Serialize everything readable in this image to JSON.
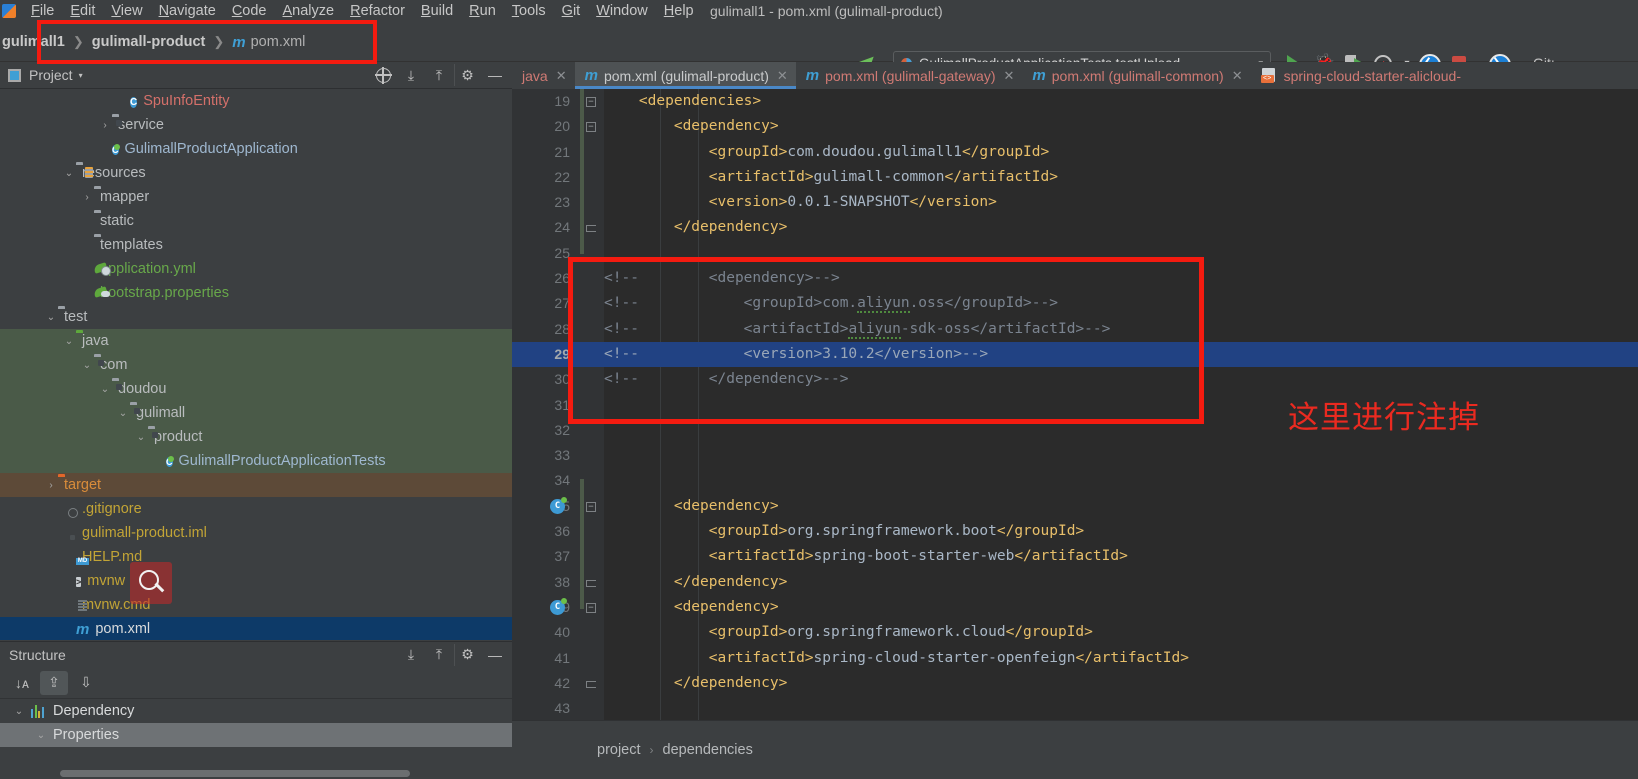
{
  "menu": {
    "items": [
      "File",
      "Edit",
      "View",
      "Navigate",
      "Code",
      "Analyze",
      "Refactor",
      "Build",
      "Run",
      "Tools",
      "Git",
      "Window",
      "Help"
    ],
    "window_title": "gulimall1 - pom.xml (gulimall-product)"
  },
  "breadcrumb": {
    "project": "gulimall1",
    "module": "gulimall-product",
    "file": "pom.xml",
    "mvn_icon": "m"
  },
  "run": {
    "config_name": "GulimallProductApplicationTests.testUpload",
    "caret": "▾",
    "git_label": "Git:"
  },
  "project_panel": {
    "title": "Project",
    "caret": "▾",
    "tree": [
      {
        "indent": 6,
        "arrow": "",
        "icon": "class-icon",
        "label": "SpuInfoEntity",
        "color": "red",
        "state": ""
      },
      {
        "indent": 5,
        "arrow": "›",
        "icon": "package-folder-icon",
        "label": "service",
        "color": "",
        "state": ""
      },
      {
        "indent": 5,
        "arrow": "",
        "icon": "springboot-class-icon",
        "label": "GulimallProductApplication",
        "color": "blue",
        "state": ""
      },
      {
        "indent": 3,
        "arrow": "⌄",
        "icon": "resources-folder-icon",
        "label": "resources",
        "color": "",
        "state": ""
      },
      {
        "indent": 4,
        "arrow": "›",
        "icon": "folder-icon",
        "label": "mapper",
        "color": "",
        "state": ""
      },
      {
        "indent": 4,
        "arrow": "",
        "icon": "folder-icon",
        "label": "static",
        "color": "",
        "state": ""
      },
      {
        "indent": 4,
        "arrow": "",
        "icon": "folder-icon",
        "label": "templates",
        "color": "",
        "state": ""
      },
      {
        "indent": 4,
        "arrow": "",
        "icon": "yaml-file-icon",
        "label": "application.yml",
        "color": "green",
        "state": ""
      },
      {
        "indent": 4,
        "arrow": "",
        "icon": "properties-file-icon",
        "label": "bootstrap.properties",
        "color": "green",
        "state": ""
      },
      {
        "indent": 2,
        "arrow": "⌄",
        "icon": "folder-icon",
        "label": "test",
        "color": "",
        "state": ""
      },
      {
        "indent": 3,
        "arrow": "⌄",
        "icon": "source-folder-icon",
        "label": "java",
        "color": "",
        "state": "sel-green"
      },
      {
        "indent": 4,
        "arrow": "⌄",
        "icon": "package-folder-icon",
        "label": "com",
        "color": "",
        "state": "sel-green"
      },
      {
        "indent": 5,
        "arrow": "⌄",
        "icon": "package-folder-icon",
        "label": "doudou",
        "color": "",
        "state": "sel-green"
      },
      {
        "indent": 6,
        "arrow": "⌄",
        "icon": "package-folder-icon",
        "label": "gulimall",
        "color": "",
        "state": "sel-green"
      },
      {
        "indent": 7,
        "arrow": "⌄",
        "icon": "package-folder-icon",
        "label": "product",
        "color": "",
        "state": "sel-green"
      },
      {
        "indent": 8,
        "arrow": "",
        "icon": "springboot-class-icon",
        "label": "GulimallProductApplicationTests",
        "color": "blue",
        "state": "sel-green"
      },
      {
        "indent": 2,
        "arrow": "›",
        "icon": "target-folder-icon",
        "label": "target",
        "color": "orange",
        "state": "sel-brown"
      },
      {
        "indent": 3,
        "arrow": "",
        "icon": "gitignore-file-icon",
        "label": ".gitignore",
        "color": "yellow",
        "state": ""
      },
      {
        "indent": 3,
        "arrow": "",
        "icon": "iml-file-icon",
        "label": "gulimall-product.iml",
        "color": "yellow",
        "state": ""
      },
      {
        "indent": 3,
        "arrow": "",
        "icon": "markdown-file-icon",
        "label": "HELP.md",
        "color": "yellow",
        "state": ""
      },
      {
        "indent": 3,
        "arrow": "",
        "icon": "shell-file-icon",
        "label": "mvnw",
        "color": "yellow",
        "state": ""
      },
      {
        "indent": 3,
        "arrow": "",
        "icon": "cmd-file-icon",
        "label": "mvnw.cmd",
        "color": "yellow",
        "state": ""
      },
      {
        "indent": 3,
        "arrow": "",
        "icon": "maven-file-icon",
        "label": "pom.xml",
        "color": "white",
        "state": "sel-blue"
      }
    ]
  },
  "structure_panel": {
    "title": "Structure",
    "rows": [
      {
        "arrow": "⌄",
        "label": "Dependency",
        "highlight": false
      },
      {
        "arrow": "⌄",
        "label": "Properties",
        "highlight": true
      }
    ]
  },
  "tabs": [
    {
      "label": "java",
      "type": "java",
      "active": false,
      "close": "✕"
    },
    {
      "label": "pom.xml (gulimall-product)",
      "type": "maven",
      "active": true,
      "close": "✕"
    },
    {
      "label": "pom.xml (gulimall-gateway)",
      "type": "maven",
      "active": false,
      "close": "✕"
    },
    {
      "label": "pom.xml (gulimall-common)",
      "type": "maven",
      "active": false,
      "close": "✕"
    },
    {
      "label": "spring-cloud-starter-alicloud-",
      "type": "xml",
      "active": false,
      "close": ""
    }
  ],
  "editor": {
    "first_line": 19,
    "highlighted_line": 29,
    "lines": [
      {
        "n": 19,
        "indent": 2,
        "text": "<dependencies>",
        "kind": "tag",
        "fold": "minus"
      },
      {
        "n": 20,
        "indent": 4,
        "text": "<dependency>",
        "kind": "tag",
        "fold": "minus"
      },
      {
        "n": 21,
        "indent": 6,
        "text": "<groupId>com.doudou.gulimall1</groupId>",
        "kind": "tag",
        "fold": ""
      },
      {
        "n": 22,
        "indent": 6,
        "text": "<artifactId>gulimall-common</artifactId>",
        "kind": "tag",
        "fold": ""
      },
      {
        "n": 23,
        "indent": 6,
        "text": "<version>0.0.1-SNAPSHOT</version>",
        "kind": "tag",
        "fold": ""
      },
      {
        "n": 24,
        "indent": 4,
        "text": "</dependency>",
        "kind": "tag",
        "fold": "end"
      },
      {
        "n": 25,
        "indent": 0,
        "text": "",
        "kind": "blank",
        "fold": ""
      },
      {
        "n": 26,
        "indent": 0,
        "text": "<!--        <dependency>-->",
        "kind": "comment",
        "fold": ""
      },
      {
        "n": 27,
        "indent": 0,
        "text": "<!--            <groupId>com.aliyun.oss</groupId>-->",
        "kind": "comment",
        "fold": ""
      },
      {
        "n": 28,
        "indent": 0,
        "text": "<!--            <artifactId>aliyun-sdk-oss</artifactId>-->",
        "kind": "comment",
        "fold": ""
      },
      {
        "n": 29,
        "indent": 0,
        "text": "<!--            <version>3.10.2</version>-->",
        "kind": "comment",
        "fold": ""
      },
      {
        "n": 30,
        "indent": 0,
        "text": "<!--        </dependency>-->",
        "kind": "comment",
        "fold": ""
      },
      {
        "n": 31,
        "indent": 0,
        "text": "",
        "kind": "blank",
        "fold": ""
      },
      {
        "n": 32,
        "indent": 0,
        "text": "",
        "kind": "blank",
        "fold": ""
      },
      {
        "n": 33,
        "indent": 0,
        "text": "",
        "kind": "blank",
        "fold": ""
      },
      {
        "n": 34,
        "indent": 0,
        "text": "",
        "kind": "blank",
        "fold": ""
      },
      {
        "n": 35,
        "indent": 4,
        "text": "<dependency>",
        "kind": "tag",
        "fold": "minus",
        "gutter": "spring"
      },
      {
        "n": 36,
        "indent": 6,
        "text": "<groupId>org.springframework.boot</groupId>",
        "kind": "tag",
        "fold": ""
      },
      {
        "n": 37,
        "indent": 6,
        "text": "<artifactId>spring-boot-starter-web</artifactId>",
        "kind": "tag",
        "fold": ""
      },
      {
        "n": 38,
        "indent": 4,
        "text": "</dependency>",
        "kind": "tag",
        "fold": "end"
      },
      {
        "n": 39,
        "indent": 4,
        "text": "<dependency>",
        "kind": "tag",
        "fold": "minus",
        "gutter": "spring"
      },
      {
        "n": 40,
        "indent": 6,
        "text": "<groupId>org.springframework.cloud</groupId>",
        "kind": "tag",
        "fold": ""
      },
      {
        "n": 41,
        "indent": 6,
        "text": "<artifactId>spring-cloud-starter-openfeign</artifactId>",
        "kind": "tag",
        "fold": ""
      },
      {
        "n": 42,
        "indent": 4,
        "text": "</dependency>",
        "kind": "tag",
        "fold": "end"
      },
      {
        "n": 43,
        "indent": 0,
        "text": "",
        "kind": "blank",
        "fold": ""
      }
    ]
  },
  "editor_breadcrumb": {
    "items": [
      "project",
      "dependencies"
    ],
    "separator": "›"
  },
  "annotations": {
    "note_text": "这里进行注掉",
    "note_color": "#ea2a20",
    "rect_color": "#f41b10"
  },
  "colors": {
    "panel_bg": "#3c3f41",
    "editor_bg": "#2b2b2b",
    "gutter_bg": "#313335",
    "selection_blue": "#214283",
    "tab_active": "#4e5254",
    "accent_blue": "#4a88c7"
  }
}
